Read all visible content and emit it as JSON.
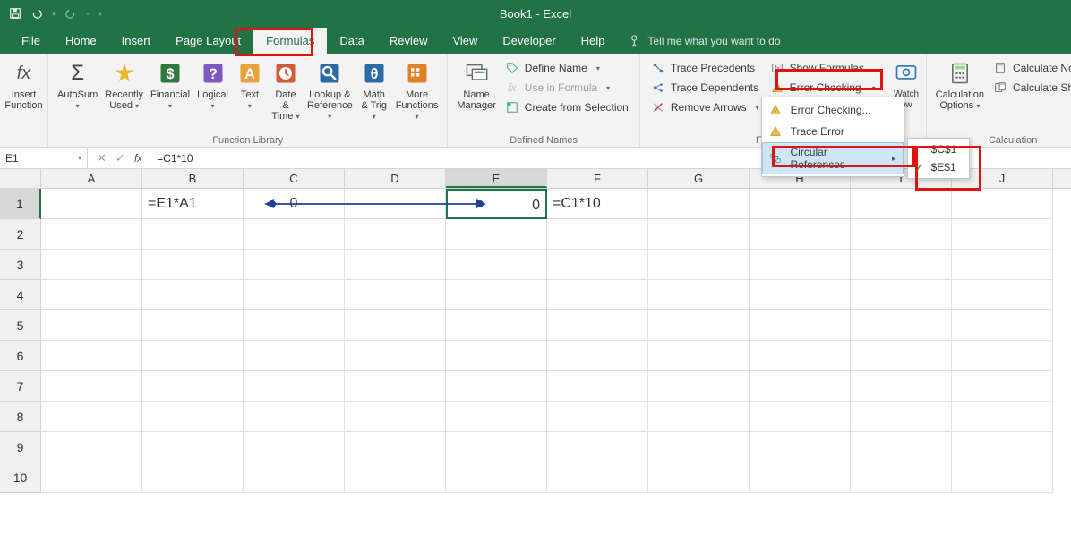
{
  "app": {
    "title": "Book1 - Excel"
  },
  "qat": {
    "undo_dd": "▾",
    "redo_dd": "▾",
    "more": "▾"
  },
  "tabs": [
    "File",
    "Home",
    "Insert",
    "Page Layout",
    "Formulas",
    "Data",
    "Review",
    "View",
    "Developer",
    "Help"
  ],
  "tellme": "Tell me what you want to do",
  "ribbon": {
    "insert_function": "Insert Function",
    "autosum": "AutoSum",
    "recently_used": "Recently Used",
    "financial": "Financial",
    "logical": "Logical",
    "text": "Text",
    "date_time": "Date & Time",
    "lookup_ref": "Lookup & Reference",
    "math_trig": "Math & Trig",
    "more_fn": "More Functions",
    "group_library": "Function Library",
    "name_manager": "Name Manager",
    "define_name": "Define Name",
    "use_in_formula": "Use in Formula",
    "create_from_sel": "Create from Selection",
    "group_names": "Defined Names",
    "trace_prec": "Trace Precedents",
    "trace_dep": "Trace Dependents",
    "remove_arrows": "Remove Arrows",
    "show_formulas": "Show Formulas",
    "error_checking": "Error Checking",
    "group_audit": "For",
    "watch_window": "Watch Window",
    "calc_options": "Calculation Options",
    "calc_now": "Calculate Now",
    "calc_sheet": "Calculate Sheet",
    "group_calc": "Calculation",
    "ow": "ow"
  },
  "ec_menu": {
    "error_checking": "Error Checking...",
    "trace_error": "Trace Error",
    "circular_refs": "Circular References"
  },
  "ref_popup": {
    "r1": "$C$1",
    "r2": "$E$1"
  },
  "formulabar": {
    "name": "E1",
    "formula": "=C1*10"
  },
  "columns": [
    "A",
    "B",
    "C",
    "D",
    "E",
    "F",
    "G",
    "H",
    "I",
    "J"
  ],
  "rows": [
    "1",
    "2",
    "3",
    "4",
    "5",
    "6",
    "7",
    "8",
    "9",
    "10"
  ],
  "cells": {
    "B1": "=E1*A1",
    "C1": "0",
    "E1": "0",
    "F1": "=C1*10"
  }
}
